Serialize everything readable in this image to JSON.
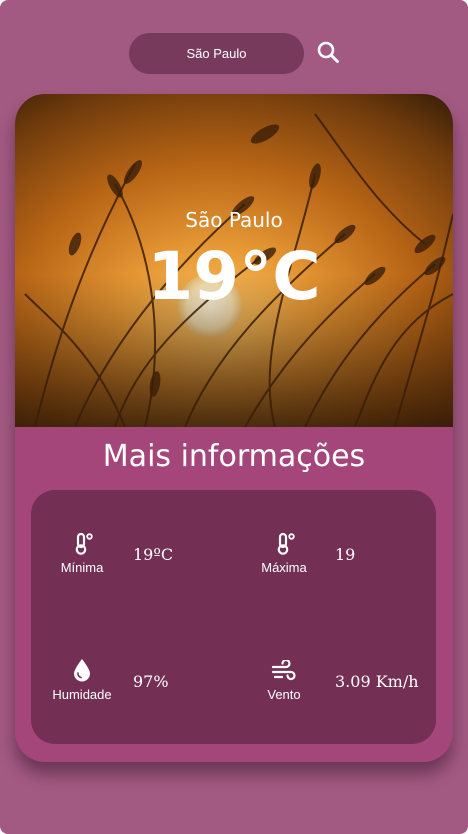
{
  "search": {
    "value": "São Paulo",
    "button_icon": "search-icon"
  },
  "weather": {
    "city": "São Paulo",
    "temperature": "19°C"
  },
  "details": {
    "title": "Mais informações",
    "metrics": [
      {
        "label": "Mínima",
        "value": "19ºC",
        "icon": "thermometer-icon"
      },
      {
        "label": "Máxima",
        "value": "19",
        "icon": "thermometer-icon"
      },
      {
        "label": "Humidade",
        "value": "97%",
        "icon": "water-drop-icon"
      },
      {
        "label": "Vento",
        "value": "3.09 Km/h",
        "icon": "wind-icon"
      }
    ]
  },
  "colors": {
    "background": "#a35a82",
    "card": "#a5467b",
    "panel": "#742f55",
    "search_bar": "#773a5d",
    "text": "#ffffff"
  }
}
